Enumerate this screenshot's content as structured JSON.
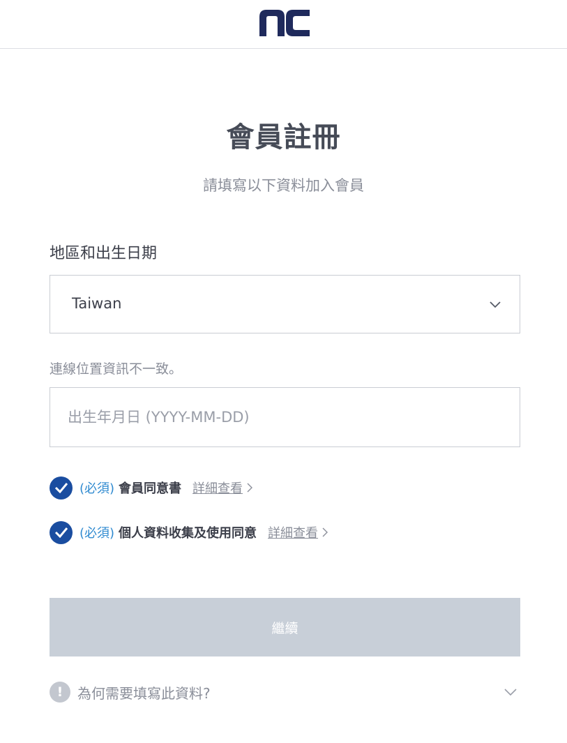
{
  "header": {
    "logo_alt": "nc"
  },
  "page": {
    "title": "會員註冊",
    "subtitle": "請填寫以下資料加入會員"
  },
  "region_section": {
    "label": "地區和出生日期",
    "selected_region": "Taiwan",
    "warning": "連線位置資訊不一致。",
    "birthdate_value": "",
    "birthdate_placeholder": "出生年月日 (YYYY-MM-DD)"
  },
  "agreements": [
    {
      "required_label": "(必須)",
      "title": "會員同意書",
      "detail_label": "詳細查看",
      "checked": true
    },
    {
      "required_label": "(必須)",
      "title": "個人資料收集及使用同意",
      "detail_label": "詳細查看",
      "checked": true
    }
  ],
  "actions": {
    "continue_label": "繼續"
  },
  "faq": {
    "icon_text": "!",
    "question": "為何需要填寫此資料?"
  },
  "colors": {
    "brand_navy": "#1f2a5c",
    "check_blue": "#1a4da0",
    "required_blue": "#2f8ad0",
    "disabled_button": "#c8cfd8"
  }
}
